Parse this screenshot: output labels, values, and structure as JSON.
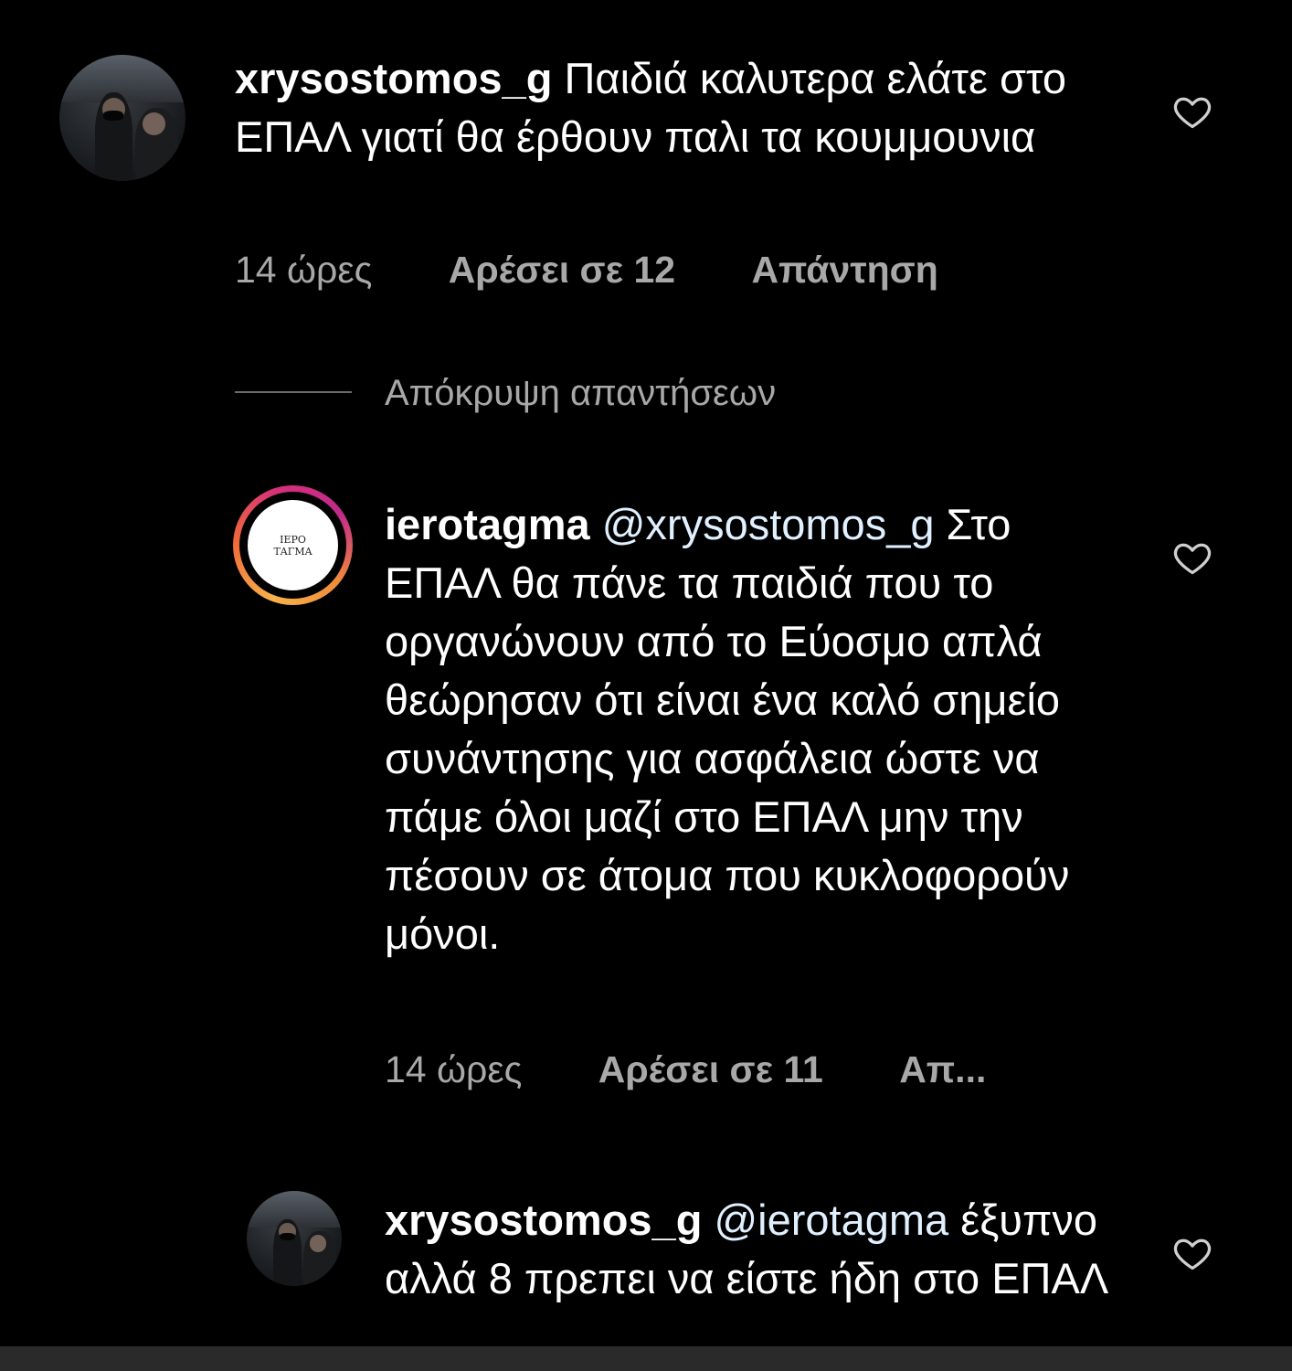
{
  "comments": [
    {
      "username": "xrysostomos_g",
      "mention": "",
      "text": "Παιδιά καλυτερα ελάτε στο ΕΠΑΛ γιατί θα έρθουν παλι τα κουμμουνια",
      "time": "14 ώρες",
      "likes": "Αρέσει σε 12",
      "reply": "Απάντηση",
      "avatar": "photo-avatar"
    },
    {
      "username": "ierotagma",
      "mention": "@xrysostomos_g",
      "text": "Στο ΕΠΑΛ θα πάνε τα παιδιά που το οργανώνουν από το Εύοσμο απλά θεώρησαν ότι είναι ένα καλό σημείο συνάντησης για ασφάλεια ώστε να πάμε όλοι μαζί στο ΕΠΑΛ μην την πέσουν σε άτομα που κυκλοφορούν μόνοι.",
      "time": "14 ώρες",
      "likes": "Αρέσει σε 11",
      "reply": "Απ...",
      "avatar_logo_line1": "ΙΕΡΟ",
      "avatar_logo_line2": "ΤΑΓΜΑ"
    },
    {
      "username": "xrysostomos_g",
      "mention": "@ierotagma",
      "text": "έξυπνο αλλά 8 πρεπει να είστε ήδη στο ΕΠΑΛ",
      "avatar": "photo-avatar"
    }
  ],
  "hide_replies": "Απόκρυψη απαντήσεων",
  "icons": {
    "like": "heart-outline-icon"
  },
  "colors": {
    "background": "#000000",
    "text": "#ffffff",
    "meta": "#a8a8a8",
    "mention": "#e0f0ff"
  }
}
